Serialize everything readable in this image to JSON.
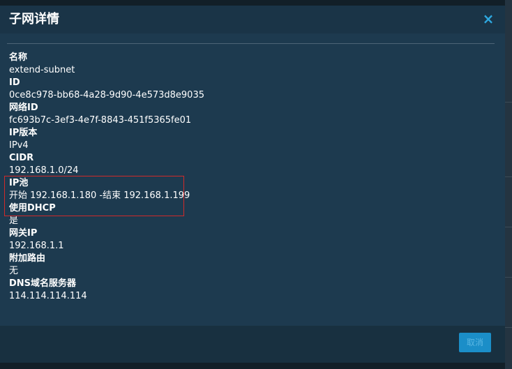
{
  "dialog": {
    "title": "子网详情",
    "close_symbol": "×",
    "fields": [
      {
        "label": "名称",
        "value": "extend-subnet"
      },
      {
        "label": "ID",
        "value": "0ce8c978-bb68-4a28-9d90-4e573d8e9035"
      },
      {
        "label": "网络ID",
        "value": "fc693b7c-3ef3-4e7f-8843-451f5365fe01"
      },
      {
        "label": "IP版本",
        "value": "IPv4"
      },
      {
        "label": "CIDR",
        "value": "192.168.1.0/24"
      },
      {
        "label": "IP池",
        "value": "开始 192.168.1.180 -结束 192.168.1.199"
      },
      {
        "label": "使用DHCP",
        "value": "是"
      },
      {
        "label": "网关IP",
        "value": "192.168.1.1"
      },
      {
        "label": "附加路由",
        "value": "无"
      },
      {
        "label": "DNS域名服务器",
        "value": "114.114.114.114"
      }
    ],
    "cancel_label": "取消"
  },
  "colors": {
    "accent": "#2ea8e0",
    "highlight_border": "#d02a2a",
    "modal_bg": "#1d3a4f"
  }
}
